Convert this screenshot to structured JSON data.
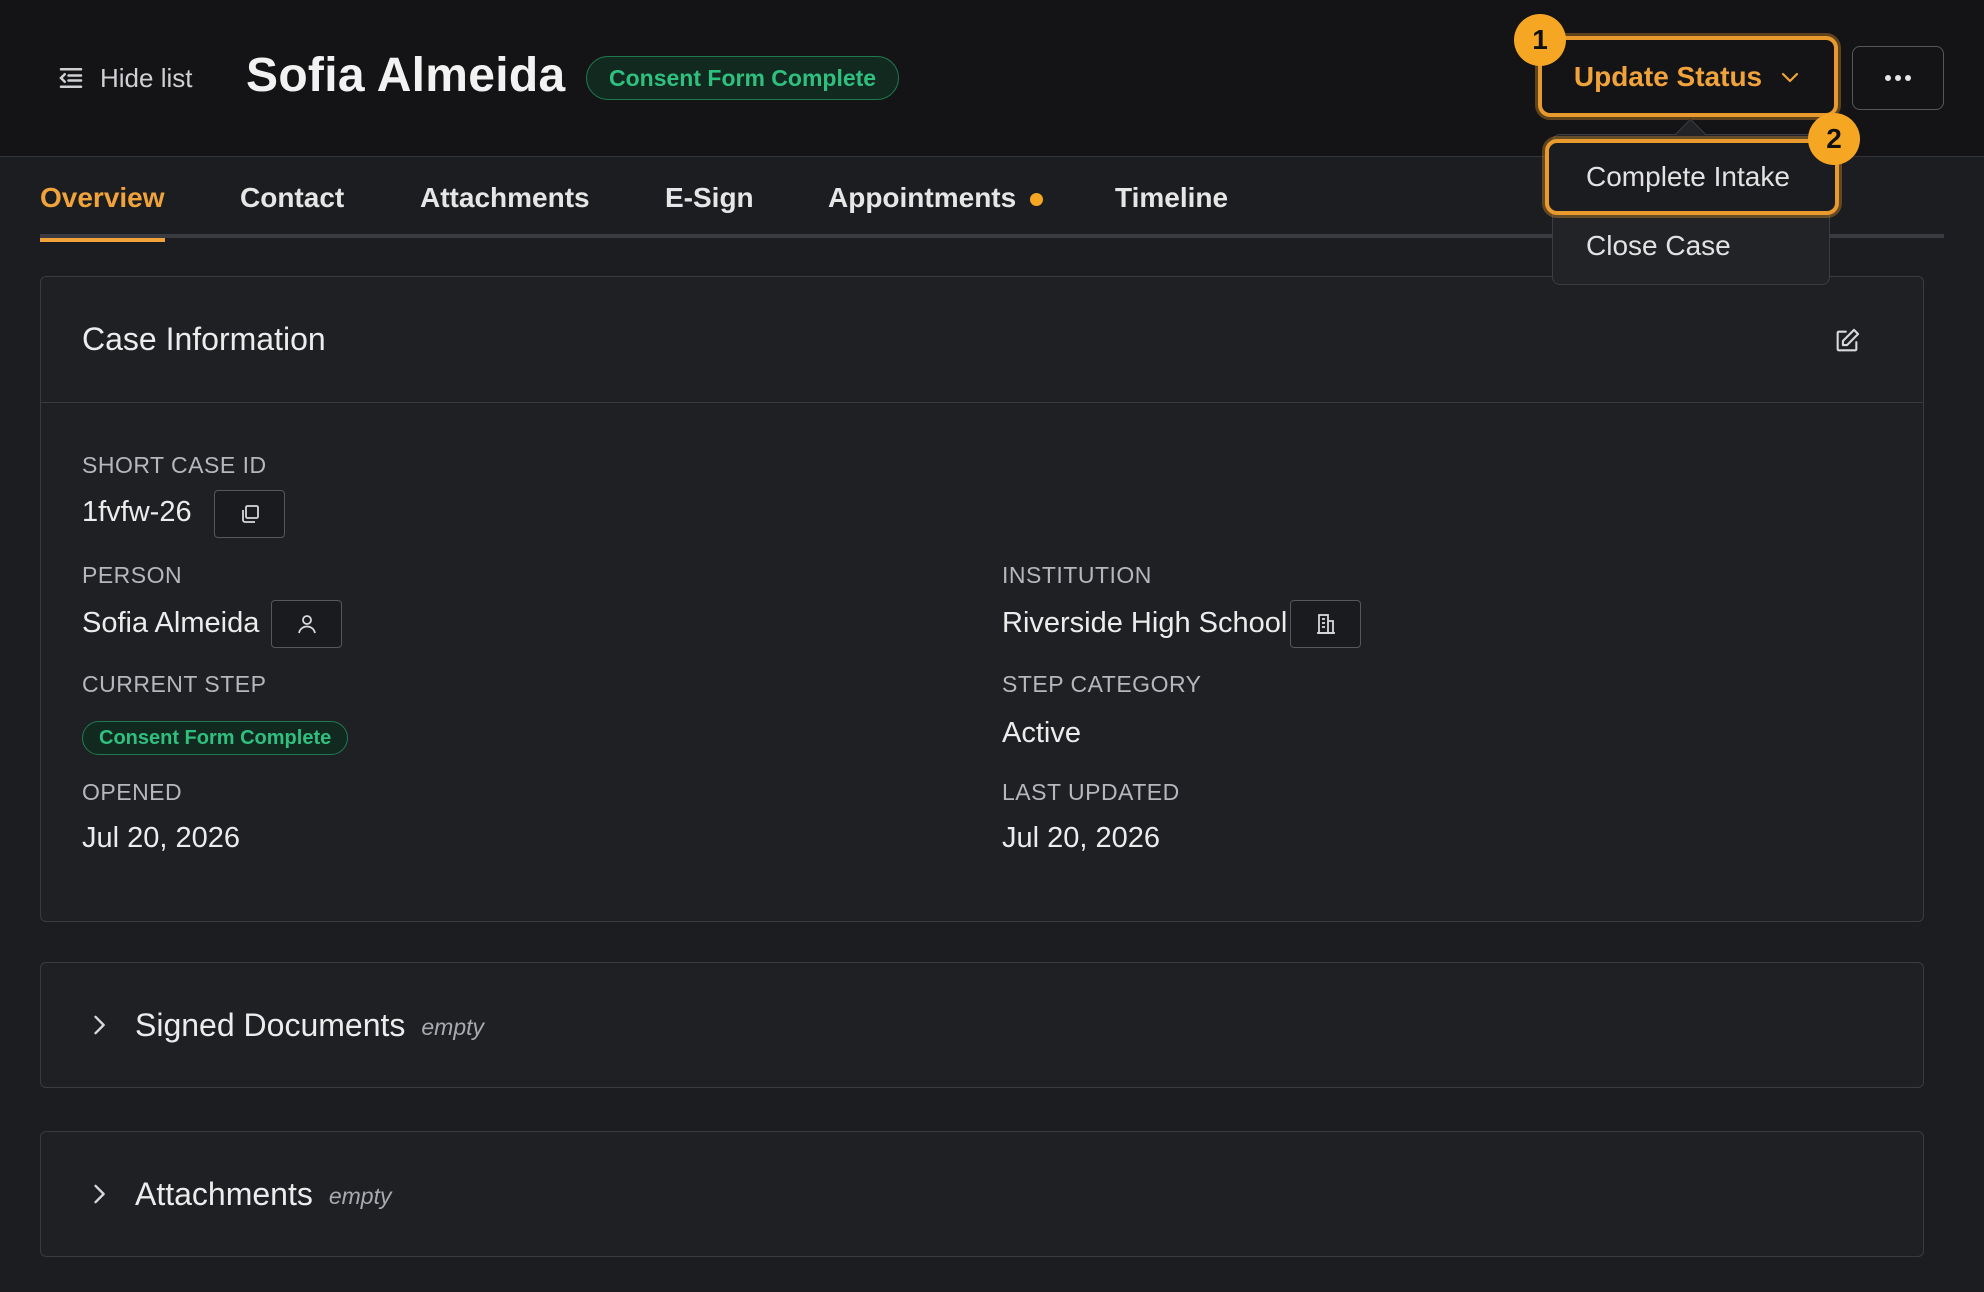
{
  "header": {
    "hide_list_label": "Hide list",
    "title": "Sofia Almeida",
    "status_pill": "Consent Form Complete",
    "update_status_label": "Update Status",
    "badge_1": "1",
    "badge_2": "2"
  },
  "dropdown": {
    "items": [
      {
        "label": "Complete Intake"
      },
      {
        "label": "Close Case"
      }
    ]
  },
  "tabs": [
    {
      "label": "Overview",
      "active": true
    },
    {
      "label": "Contact"
    },
    {
      "label": "Attachments"
    },
    {
      "label": "E-Sign"
    },
    {
      "label": "Appointments",
      "dot": true
    },
    {
      "label": "Timeline"
    }
  ],
  "case_info": {
    "title": "Case Information",
    "short_case_id_label": "SHORT CASE ID",
    "short_case_id": "1fvfw-26",
    "person_label": "PERSON",
    "person": "Sofia Almeida",
    "institution_label": "INSTITUTION",
    "institution": "Riverside High School",
    "current_step_label": "CURRENT STEP",
    "current_step": "Consent Form Complete",
    "step_category_label": "STEP CATEGORY",
    "step_category": "Active",
    "opened_label": "OPENED",
    "opened": "Jul 20, 2026",
    "last_updated_label": "LAST UPDATED",
    "last_updated": "Jul 20, 2026"
  },
  "sections": {
    "signed_documents": {
      "title": "Signed Documents",
      "empty_label": "empty"
    },
    "attachments": {
      "title": "Attachments",
      "empty_label": "empty"
    }
  },
  "colors": {
    "accent": "#f0a33a",
    "success": "#2fbf7f",
    "background": "#1c1d20"
  }
}
